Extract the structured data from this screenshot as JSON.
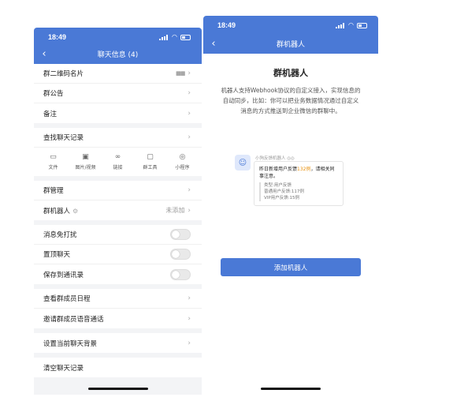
{
  "left": {
    "status_time": "18:49",
    "title": "聊天信息 (4)",
    "group1": [
      "群二维码名片",
      "群公告",
      "备注"
    ],
    "qr_text": "▦▦",
    "search_label": "查找聊天记录",
    "tools": [
      {
        "label": "文件",
        "icon": "folder-icon"
      },
      {
        "label": "图片/视频",
        "icon": "image-icon"
      },
      {
        "label": "链接",
        "icon": "link-icon"
      },
      {
        "label": "群工具",
        "icon": "tools-icon"
      },
      {
        "label": "小程序",
        "icon": "miniprogram-icon"
      }
    ],
    "manage_label": "群管理",
    "bot_label": "群机器人",
    "bot_value": "未添加",
    "toggles": [
      "消息免打扰",
      "置顶聊天",
      "保存到通讯录"
    ],
    "group4": [
      "查看群成员日程",
      "邀请群成员语音通话"
    ],
    "background_label": "设置当前聊天背景",
    "clear_label": "清空聊天记录"
  },
  "right": {
    "status_time": "18:49",
    "title": "群机器人",
    "heading": "群机器人",
    "description": "机器人支持Webhook协议的自定义接入，实现信息的自动同步，比如：你可以把业务数据情况通过自定义消息的方式推送到企业微信的群聊中。",
    "preview": {
      "bot_name": "小狗反馈机器人 ◎◎",
      "line_a": "昨日新增用户反馈",
      "line_count": "132例",
      "line_b": "，请相关同事注意。",
      "quote": [
        "类型:用户反馈",
        "普通用户反馈:117例",
        "VIP用户反馈:15例"
      ]
    },
    "add_button": "添加机器人"
  },
  "colors": {
    "accent": "#4a79d6",
    "highlight": "#e8900c"
  }
}
